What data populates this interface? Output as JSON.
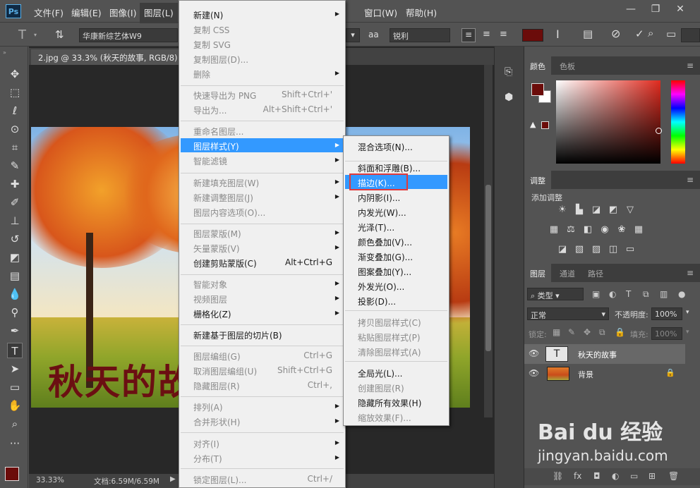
{
  "menubar": {
    "logo": "Ps",
    "items": [
      "文件(F)",
      "编辑(E)",
      "图像(I)",
      "图层(L)",
      "窗口(W)",
      "帮助(H)"
    ]
  },
  "window_controls": [
    "—",
    "❐",
    "✕"
  ],
  "options": {
    "font_family": "华康新综艺体W9",
    "antialias_icon": "aa",
    "antialias": "锐利"
  },
  "document": {
    "tab_title": "2.jpg @ 33.3% (秋天的故事, RGB/8) *",
    "tab_close": "×",
    "canvas_text": "秋天的故",
    "zoom": "33.33%",
    "doc_size": "文档:6.59M/6.59M"
  },
  "layer_menu": {
    "items": [
      {
        "label": "新建(N)",
        "shortcut": "",
        "submenu": true,
        "disabled": false
      },
      {
        "label": "复制 CSS",
        "shortcut": "",
        "submenu": false,
        "disabled": true
      },
      {
        "label": "复制 SVG",
        "shortcut": "",
        "submenu": false,
        "disabled": true
      },
      {
        "label": "复制图层(D)...",
        "shortcut": "",
        "submenu": false,
        "disabled": true
      },
      {
        "label": "删除",
        "shortcut": "",
        "submenu": true,
        "disabled": true
      },
      {
        "label": "快速导出为 PNG",
        "shortcut": "Shift+Ctrl+'",
        "submenu": false,
        "disabled": true
      },
      {
        "label": "导出为...",
        "shortcut": "Alt+Shift+Ctrl+'",
        "submenu": false,
        "disabled": true
      },
      {
        "label": "重命名图层...",
        "shortcut": "",
        "submenu": false,
        "disabled": true
      },
      {
        "label": "图层样式(Y)",
        "shortcut": "",
        "submenu": true,
        "disabled": false,
        "highlighted": true
      },
      {
        "label": "智能滤镜",
        "shortcut": "",
        "submenu": true,
        "disabled": true
      },
      {
        "label": "新建填充图层(W)",
        "shortcut": "",
        "submenu": true,
        "disabled": true
      },
      {
        "label": "新建调整图层(J)",
        "shortcut": "",
        "submenu": true,
        "disabled": true
      },
      {
        "label": "图层内容选项(O)...",
        "shortcut": "",
        "submenu": false,
        "disabled": true
      },
      {
        "label": "图层蒙版(M)",
        "shortcut": "",
        "submenu": true,
        "disabled": true
      },
      {
        "label": "矢量蒙版(V)",
        "shortcut": "",
        "submenu": true,
        "disabled": true
      },
      {
        "label": "创建剪贴蒙版(C)",
        "shortcut": "Alt+Ctrl+G",
        "submenu": false,
        "disabled": false
      },
      {
        "label": "智能对象",
        "shortcut": "",
        "submenu": true,
        "disabled": true
      },
      {
        "label": "视频图层",
        "shortcut": "",
        "submenu": true,
        "disabled": true
      },
      {
        "label": "栅格化(Z)",
        "shortcut": "",
        "submenu": true,
        "disabled": false
      },
      {
        "label": "新建基于图层的切片(B)",
        "shortcut": "",
        "submenu": false,
        "disabled": false
      },
      {
        "label": "图层编组(G)",
        "shortcut": "Ctrl+G",
        "submenu": false,
        "disabled": true
      },
      {
        "label": "取消图层编组(U)",
        "shortcut": "Shift+Ctrl+G",
        "submenu": false,
        "disabled": true
      },
      {
        "label": "隐藏图层(R)",
        "shortcut": "Ctrl+,",
        "submenu": false,
        "disabled": true
      },
      {
        "label": "排列(A)",
        "shortcut": "",
        "submenu": true,
        "disabled": true
      },
      {
        "label": "合并形状(H)",
        "shortcut": "",
        "submenu": true,
        "disabled": true
      },
      {
        "label": "对齐(I)",
        "shortcut": "",
        "submenu": true,
        "disabled": true
      },
      {
        "label": "分布(T)",
        "shortcut": "",
        "submenu": true,
        "disabled": true
      },
      {
        "label": "锁定图层(L)...",
        "shortcut": "Ctrl+/",
        "submenu": false,
        "disabled": true
      }
    ]
  },
  "style_submenu": {
    "items": [
      {
        "label": "混合选项(N)...",
        "disabled": false
      },
      {
        "label": "斜面和浮雕(B)...",
        "disabled": false
      },
      {
        "label": "描边(K)...",
        "disabled": false,
        "highlighted": true
      },
      {
        "label": "内阴影(I)...",
        "disabled": false
      },
      {
        "label": "内发光(W)...",
        "disabled": false
      },
      {
        "label": "光泽(T)...",
        "disabled": false
      },
      {
        "label": "颜色叠加(V)...",
        "disabled": false
      },
      {
        "label": "渐变叠加(G)...",
        "disabled": false
      },
      {
        "label": "图案叠加(Y)...",
        "disabled": false
      },
      {
        "label": "外发光(O)...",
        "disabled": false
      },
      {
        "label": "投影(D)...",
        "disabled": false
      },
      {
        "label": "拷贝图层样式(C)",
        "disabled": true
      },
      {
        "label": "粘贴图层样式(P)",
        "disabled": true
      },
      {
        "label": "清除图层样式(A)",
        "disabled": true
      },
      {
        "label": "全局光(L)...",
        "disabled": false
      },
      {
        "label": "创建图层(R)",
        "disabled": true
      },
      {
        "label": "隐藏所有效果(H)",
        "disabled": false
      },
      {
        "label": "缩放效果(F)...",
        "disabled": true
      }
    ]
  },
  "color_panel": {
    "tabs": [
      "颜色",
      "色板"
    ],
    "foreground": "#6b0c0a",
    "background": "#ffffff",
    "gamut_warning": "!"
  },
  "adjust_panel": {
    "tab": "调整",
    "add_label": "添加调整"
  },
  "layers_panel": {
    "tabs": [
      "图层",
      "通道",
      "路径"
    ],
    "filter_kind": "类型",
    "blend_mode": "正常",
    "opacity_label": "不透明度:",
    "opacity_value": "100%",
    "lock_label": "锁定:",
    "fill_label": "填充:",
    "fill_value": "100%",
    "layers": [
      {
        "name": "秋天的故事",
        "thumb": "T"
      },
      {
        "name": "背景",
        "thumb": ""
      }
    ]
  },
  "watermark": {
    "line1": "Bai du 经验",
    "line2": "jingyan.baidu.com"
  }
}
